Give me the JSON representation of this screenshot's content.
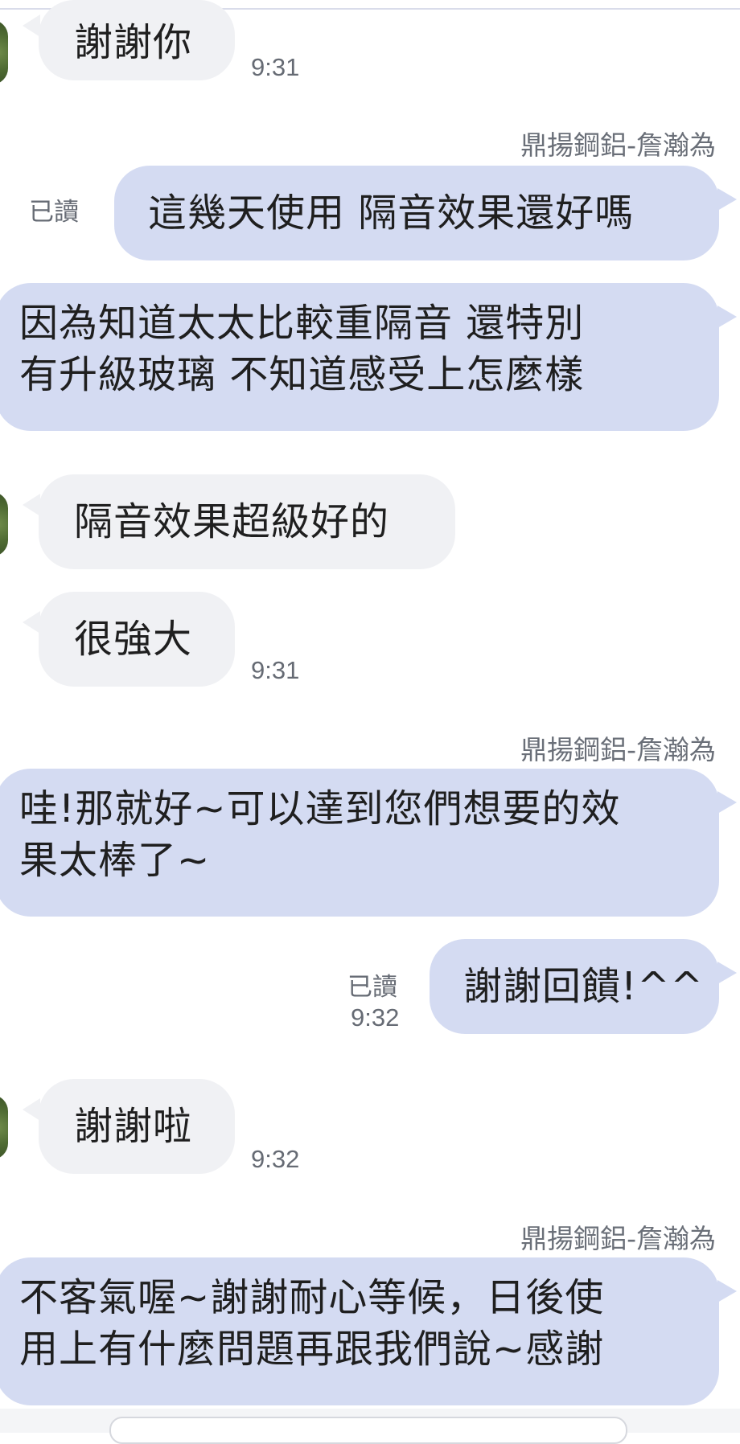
{
  "chat": {
    "sender_name": "鼎揚鋼鋁-詹瀚為",
    "read_label": "已讀",
    "messages": [
      {
        "direction": "in",
        "lines": [
          "謝謝你"
        ],
        "time": "9:31"
      },
      {
        "direction": "out",
        "lines": [
          "這幾天使用 隔音效果還好嗎"
        ],
        "read": "已讀"
      },
      {
        "direction": "out",
        "lines": [
          "因為知道太太比較重隔音 還特別",
          "有升級玻璃 不知道感受上怎麼樣"
        ]
      },
      {
        "direction": "in",
        "lines": [
          "隔音效果超級好的"
        ]
      },
      {
        "direction": "in",
        "lines": [
          "很強大"
        ],
        "time": "9:31"
      },
      {
        "direction": "out",
        "lines": [
          "哇!那就好~可以達到您們想要的效",
          "果太棒了~"
        ]
      },
      {
        "direction": "out",
        "lines": [
          "謝謝回饋!^^"
        ],
        "read": "已讀",
        "time": "9:32"
      },
      {
        "direction": "in",
        "lines": [
          "謝謝啦"
        ],
        "time": "9:32"
      },
      {
        "direction": "out",
        "lines": [
          "不客氣喔~謝謝耐心等候，日後使",
          "用上有什麼問題再跟我們說~感謝"
        ]
      }
    ]
  },
  "colors": {
    "incoming_bubble": "#f0f1f4",
    "outgoing_bubble": "#d4dbf2",
    "meta_text": "#666b74"
  },
  "icons": {
    "avatar": "contact-avatar-icon"
  }
}
